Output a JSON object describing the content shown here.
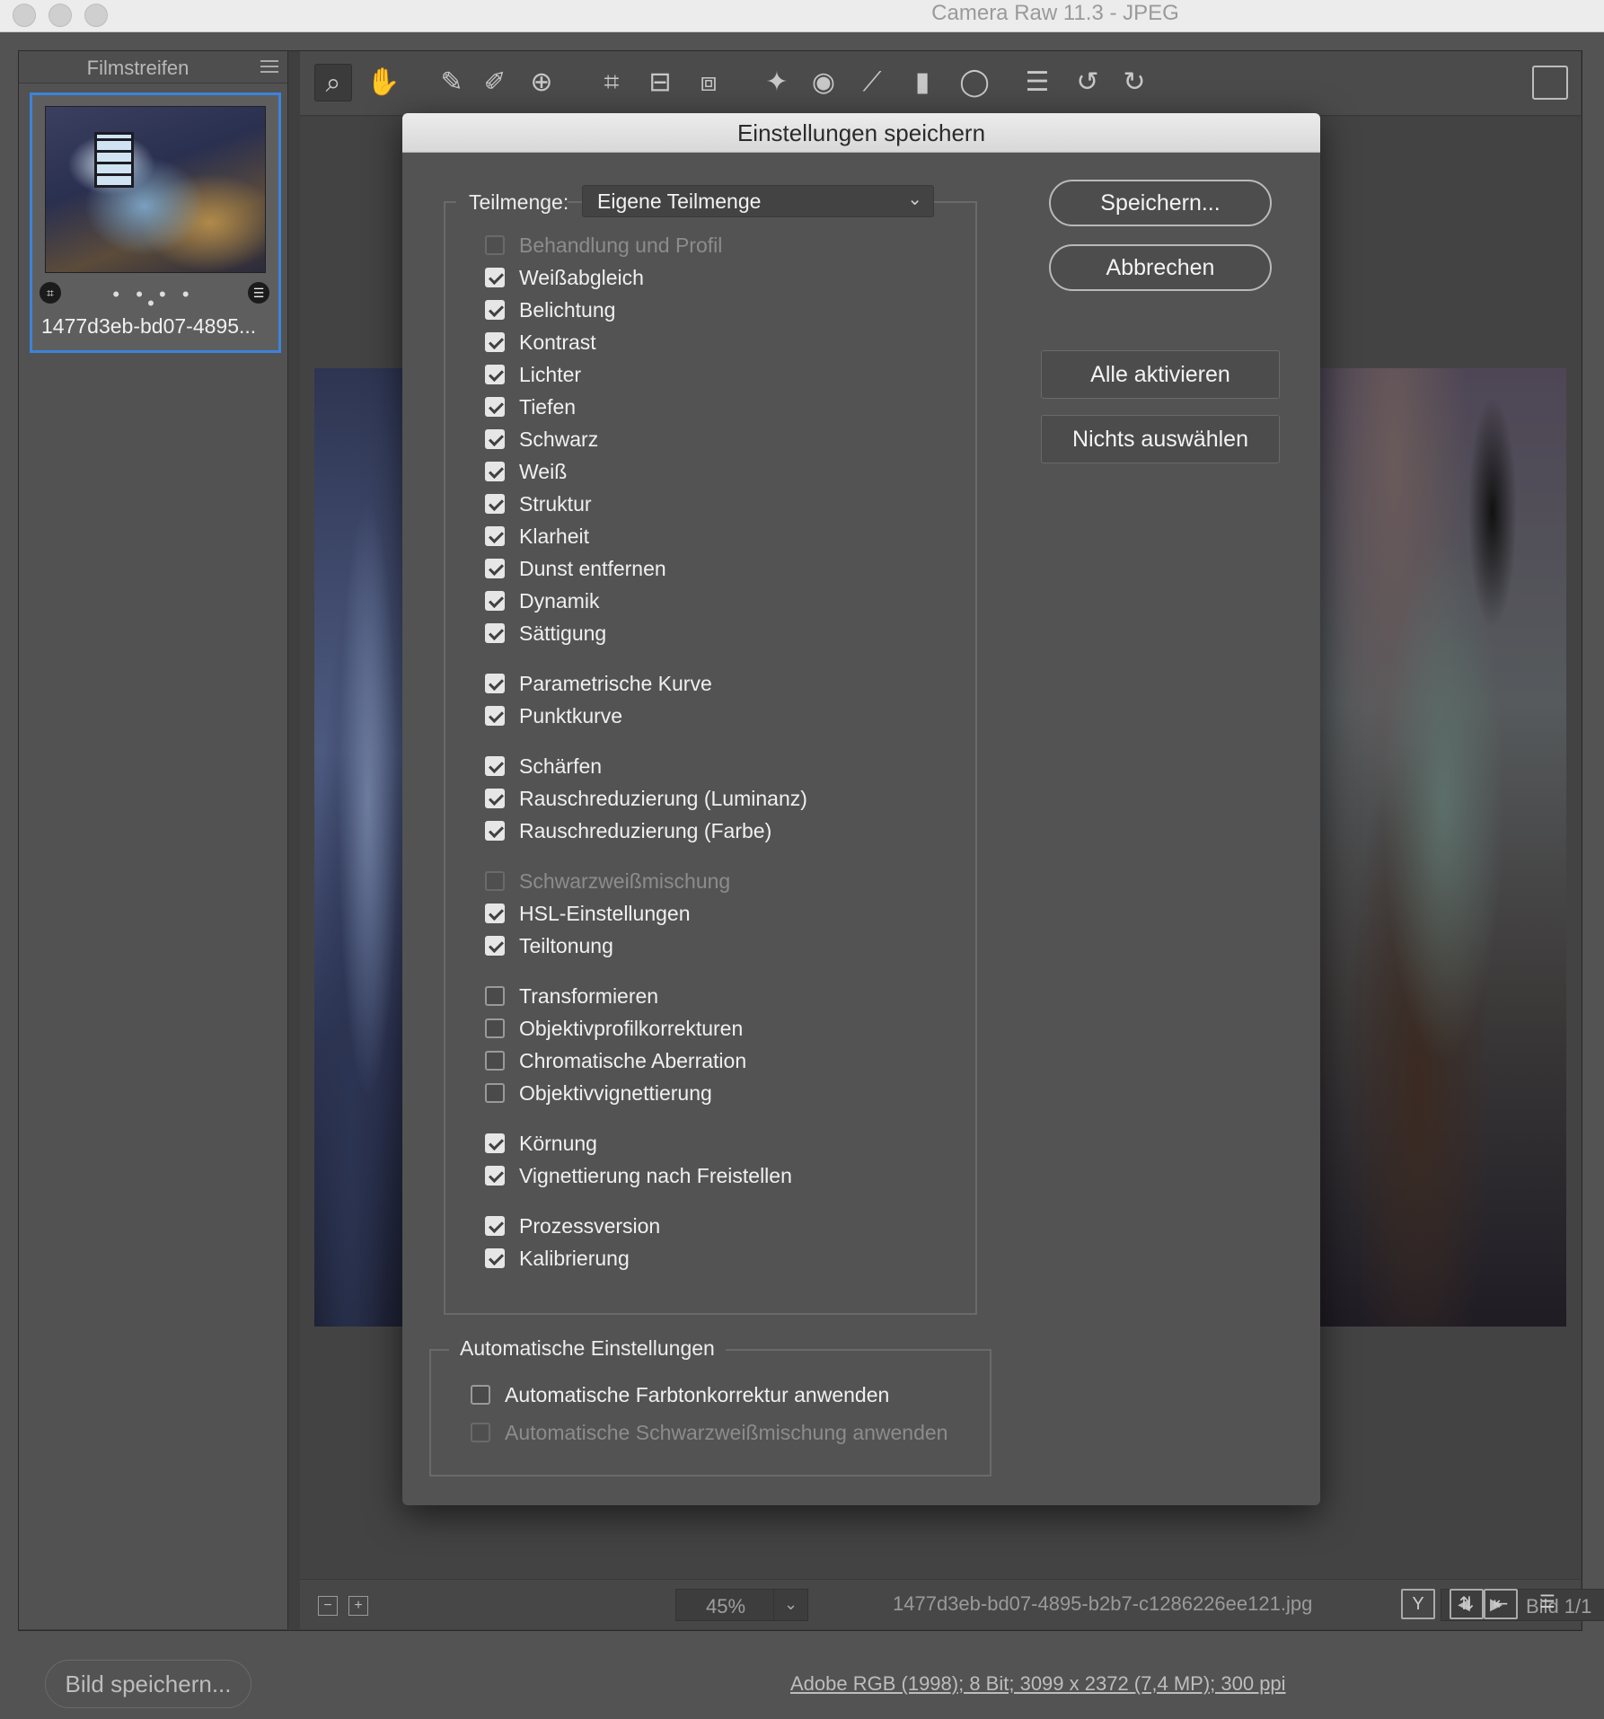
{
  "window": {
    "title": "Camera Raw 11.3 - JPEG"
  },
  "filmstrip": {
    "title": "Filmstreifen",
    "thumbnail_name": "1477d3eb-bd07-4895...",
    "dots": "• • • • •"
  },
  "toolbar": {
    "tools": [
      {
        "name": "zoom-tool-icon",
        "glyph": "⌕"
      },
      {
        "name": "hand-tool-icon",
        "glyph": "✋"
      },
      {
        "name": "white-balance-tool-icon",
        "glyph": "✎"
      },
      {
        "name": "color-sampler-tool-icon",
        "glyph": "✐"
      },
      {
        "name": "targeted-adjustment-tool-icon",
        "glyph": "⊕"
      },
      {
        "name": "crop-tool-icon",
        "glyph": "⌗"
      },
      {
        "name": "straighten-tool-icon",
        "glyph": "⊟"
      },
      {
        "name": "transform-tool-icon",
        "glyph": "⧈"
      },
      {
        "name": "spot-removal-tool-icon",
        "glyph": "✦"
      },
      {
        "name": "red-eye-tool-icon",
        "glyph": "◉"
      },
      {
        "name": "adjustment-brush-icon",
        "glyph": "⟋"
      },
      {
        "name": "graduated-filter-icon",
        "glyph": "▮"
      },
      {
        "name": "radial-filter-icon",
        "glyph": "◯"
      },
      {
        "name": "preferences-icon",
        "glyph": "☰"
      },
      {
        "name": "rotate-left-icon",
        "glyph": "↺"
      },
      {
        "name": "rotate-right-icon",
        "glyph": "↻"
      }
    ]
  },
  "dialog": {
    "title": "Einstellungen speichern",
    "subset_label": "Teilmenge:",
    "subset_value": "Eigene Teilmenge",
    "buttons": {
      "save": "Speichern...",
      "cancel": "Abbrechen",
      "check_all": "Alle aktivieren",
      "check_none": "Nichts auswählen"
    },
    "settings": [
      {
        "label": "Behandlung und Profil",
        "checked": false,
        "disabled": true
      },
      {
        "label": "Weißabgleich",
        "checked": true
      },
      {
        "label": "Belichtung",
        "checked": true
      },
      {
        "label": "Kontrast",
        "checked": true
      },
      {
        "label": "Lichter",
        "checked": true
      },
      {
        "label": "Tiefen",
        "checked": true
      },
      {
        "label": "Schwarz",
        "checked": true
      },
      {
        "label": "Weiß",
        "checked": true
      },
      {
        "label": "Struktur",
        "checked": true
      },
      {
        "label": "Klarheit",
        "checked": true
      },
      {
        "label": "Dunst entfernen",
        "checked": true
      },
      {
        "label": "Dynamik",
        "checked": true
      },
      {
        "label": "Sättigung",
        "checked": true
      },
      {
        "label": "Parametrische Kurve",
        "checked": true
      },
      {
        "label": "Punktkurve",
        "checked": true
      },
      {
        "label": "Schärfen",
        "checked": true
      },
      {
        "label": "Rauschreduzierung (Luminanz)",
        "checked": true
      },
      {
        "label": "Rauschreduzierung (Farbe)",
        "checked": true
      },
      {
        "label": "Schwarzweißmischung",
        "checked": false,
        "disabled": true
      },
      {
        "label": "HSL-Einstellungen",
        "checked": true
      },
      {
        "label": "Teiltonung",
        "checked": true
      },
      {
        "label": "Transformieren",
        "checked": false
      },
      {
        "label": "Objektivprofilkorrekturen",
        "checked": false
      },
      {
        "label": "Chromatische Aberration",
        "checked": false
      },
      {
        "label": "Objektivvignettierung",
        "checked": false
      },
      {
        "label": "Körnung",
        "checked": true
      },
      {
        "label": "Vignettierung nach Freistellen",
        "checked": true
      },
      {
        "label": "Prozessversion",
        "checked": true
      },
      {
        "label": "Kalibrierung",
        "checked": true
      }
    ],
    "auto": {
      "title": "Automatische Einstellungen",
      "items": [
        {
          "label": "Automatische Farbtonkorrektur anwenden",
          "checked": false
        },
        {
          "label": "Automatische Schwarzweißmischung anwenden",
          "checked": false,
          "disabled": true
        }
      ]
    }
  },
  "preview_bar": {
    "zoom_value": "45%",
    "file_name": "1477d3eb-bd07-4895-b2b7-c1286226ee121.jpg",
    "image_counter": "Bild 1/1"
  },
  "footer": {
    "save_image": "Bild speichern...",
    "workflow_info": "Adobe RGB (1998); 8 Bit; 3099 x 2372 (7,4 MP); 300 ppi"
  }
}
